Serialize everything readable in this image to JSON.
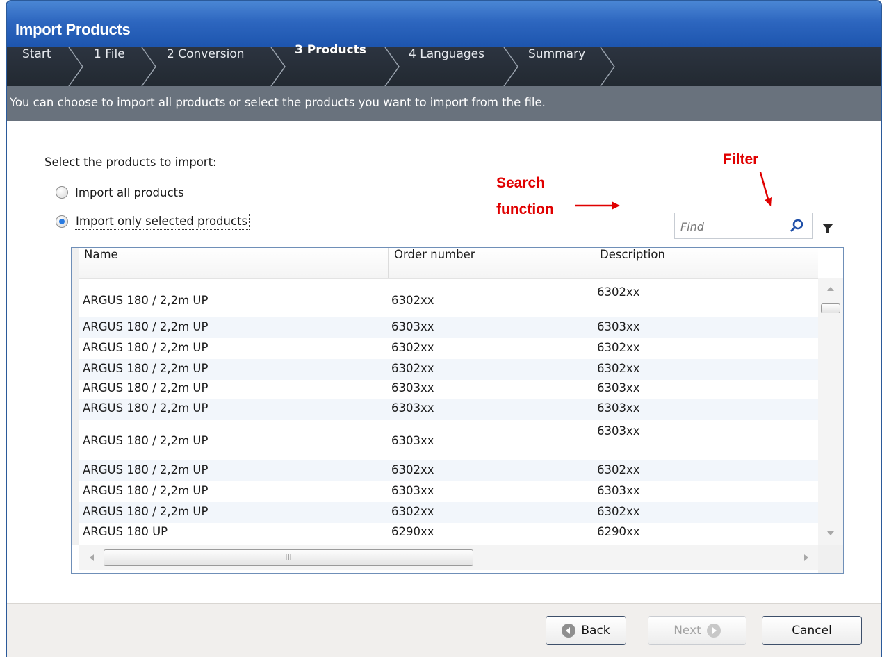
{
  "window": {
    "title": "Import Products"
  },
  "steps": [
    {
      "label": "Start",
      "active": false
    },
    {
      "label": "1 File",
      "active": false
    },
    {
      "label": "2 Conversion",
      "active": false
    },
    {
      "label": "3 Products",
      "active": true
    },
    {
      "label": "4 Languages",
      "active": false
    },
    {
      "label": "Summary",
      "active": false
    }
  ],
  "description": "You can choose to import all products or select the products you want to import from the file.",
  "selection": {
    "prompt": "Select the products to import:",
    "option_all": "Import all products",
    "option_selected": "Import only selected products",
    "selected": "option_selected"
  },
  "annotations": {
    "search_line1": "Search",
    "search_line2": "function",
    "filter": "Filter"
  },
  "search": {
    "placeholder": "Find",
    "icon": "search-icon"
  },
  "filter_icon": "funnel-icon",
  "table": {
    "columns": [
      "Name",
      "Order number",
      "Description"
    ],
    "rows": [
      [
        "ARGUS 180 / 2,2m UP",
        "6302xx",
        "6302xx"
      ],
      [
        "ARGUS 180 / 2,2m UP",
        "6303xx",
        "6303xx"
      ],
      [
        "ARGUS 180 / 2,2m UP",
        "6302xx",
        "6302xx"
      ],
      [
        "ARGUS 180 / 2,2m UP",
        "6302xx",
        "6302xx"
      ],
      [
        "ARGUS 180 / 2,2m UP",
        "6303xx",
        "6303xx"
      ],
      [
        "ARGUS 180 / 2,2m UP",
        "6303xx",
        "6303xx"
      ],
      [
        "ARGUS 180 / 2,2m UP",
        "6303xx",
        "6303xx"
      ],
      [
        "ARGUS 180 / 2,2m UP",
        "6302xx",
        "6302xx"
      ],
      [
        "ARGUS 180 / 2,2m UP",
        "6303xx",
        "6303xx"
      ],
      [
        "ARGUS 180 / 2,2m UP",
        "6302xx",
        "6302xx"
      ],
      [
        "ARGUS 180 UP",
        "6290xx",
        "6290xx"
      ]
    ],
    "hscroll_grip": "III"
  },
  "buttons": {
    "back": "Back",
    "next": "Next",
    "cancel": "Cancel"
  },
  "colors": {
    "title_blue": "#2d66bf",
    "stepbar": "#262d36",
    "descbar": "#69727d",
    "annotation_red": "#e00000",
    "accent": "#2a7be0"
  }
}
